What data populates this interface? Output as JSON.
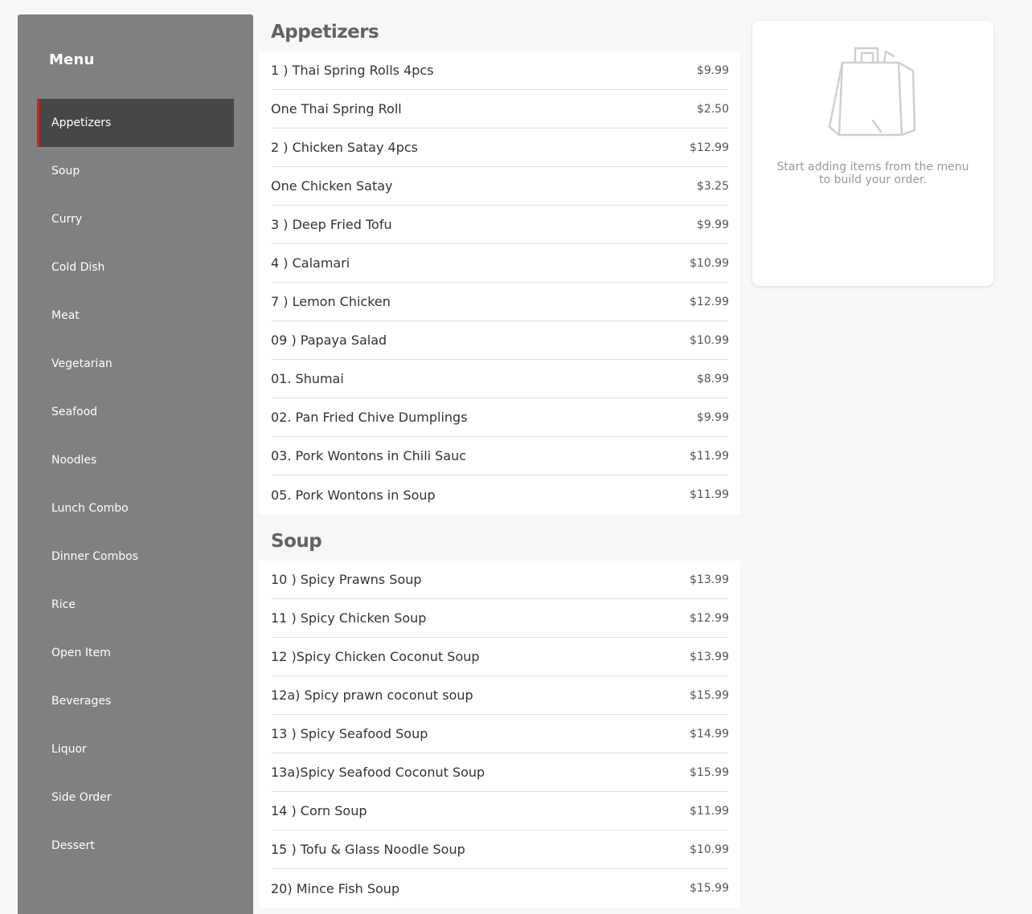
{
  "sidebar": {
    "title": "Menu",
    "items": [
      {
        "label": "Appetizers",
        "active": true
      },
      {
        "label": "Soup"
      },
      {
        "label": "Curry"
      },
      {
        "label": "Cold Dish"
      },
      {
        "label": "Meat"
      },
      {
        "label": "Vegetarian"
      },
      {
        "label": "Seafood"
      },
      {
        "label": "Noodles"
      },
      {
        "label": "Lunch Combo"
      },
      {
        "label": "Dinner Combos"
      },
      {
        "label": "Rice"
      },
      {
        "label": "Open Item"
      },
      {
        "label": "Beverages"
      },
      {
        "label": "Liquor"
      },
      {
        "label": "Side Order"
      },
      {
        "label": "Dessert"
      }
    ]
  },
  "sections": [
    {
      "title": "Appetizers",
      "items": [
        {
          "name": "1 ) Thai Spring Rolls 4pcs",
          "price": "$9.99"
        },
        {
          "name": "One Thai Spring Roll",
          "price": "$2.50"
        },
        {
          "name": "2 ) Chicken Satay 4pcs",
          "price": "$12.99"
        },
        {
          "name": "One Chicken Satay",
          "price": "$3.25"
        },
        {
          "name": "3 ) Deep Fried Tofu",
          "price": "$9.99"
        },
        {
          "name": "4 ) Calamari",
          "price": "$10.99"
        },
        {
          "name": "7 ) Lemon Chicken",
          "price": "$12.99"
        },
        {
          "name": "09 ) Papaya Salad",
          "price": "$10.99"
        },
        {
          "name": "01. Shumai",
          "price": "$8.99"
        },
        {
          "name": "02. Pan Fried Chive Dumplings",
          "price": "$9.99"
        },
        {
          "name": "03. Pork Wontons in Chili Sauc",
          "price": "$11.99"
        },
        {
          "name": "05. Pork Wontons in Soup",
          "price": "$11.99"
        }
      ]
    },
    {
      "title": "Soup",
      "items": [
        {
          "name": "10 ) Spicy Prawns Soup",
          "price": "$13.99"
        },
        {
          "name": "11 ) Spicy Chicken Soup",
          "price": "$12.99"
        },
        {
          "name": "12 )Spicy Chicken Coconut Soup",
          "price": "$13.99"
        },
        {
          "name": "12a) Spicy prawn coconut soup",
          "price": "$15.99"
        },
        {
          "name": "13 ) Spicy Seafood Soup",
          "price": "$14.99"
        },
        {
          "name": "13a)Spicy Seafood Coconut Soup",
          "price": "$15.99"
        },
        {
          "name": "14 ) Corn Soup",
          "price": "$11.99"
        },
        {
          "name": "15 ) Tofu & Glass Noodle Soup",
          "price": "$10.99"
        },
        {
          "name": "20) Mince Fish Soup",
          "price": "$15.99"
        }
      ]
    }
  ],
  "order": {
    "empty_message": "Start adding items from the menu to build your order.",
    "icon": "shopping-bag-icon"
  },
  "colors": {
    "sidebar_bg": "#808080",
    "active_bg": "#474747",
    "active_accent": "#e4161c"
  }
}
